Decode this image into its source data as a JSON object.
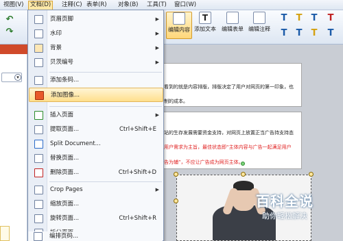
{
  "menubar": {
    "items": [
      {
        "label": "视图(V)"
      },
      {
        "label": "文档(D)"
      },
      {
        "label": "注释(C)"
      },
      {
        "label": "表单(R)"
      },
      {
        "label": "对象(B)"
      },
      {
        "label": "工具(T)"
      },
      {
        "label": "窗口(W)"
      }
    ]
  },
  "toolbar": {
    "edit_content": "编辑内容",
    "add_text": "添加文本",
    "edit_form": "编辑表单",
    "edit_annotation": "编辑注释"
  },
  "doc_menu": {
    "items": [
      {
        "label": "页眉页脚",
        "shortcut": "",
        "submenu": true
      },
      {
        "label": "水印",
        "shortcut": "",
        "submenu": true
      },
      {
        "label": "背景",
        "shortcut": "",
        "submenu": true
      },
      {
        "label": "贝茨编号",
        "shortcut": "",
        "submenu": true
      },
      {
        "label": "添加条码...",
        "shortcut": "",
        "submenu": false
      },
      {
        "label": "添加图像...",
        "shortcut": "",
        "submenu": false,
        "highlighted": true
      },
      {
        "label": "插入页面",
        "shortcut": "",
        "submenu": true
      },
      {
        "label": "提取页面...",
        "shortcut": "Ctrl+Shift+E",
        "submenu": false
      },
      {
        "label": "Split Document...",
        "shortcut": "",
        "submenu": false
      },
      {
        "label": "替换页面...",
        "shortcut": "",
        "submenu": false
      },
      {
        "label": "删除页面...",
        "shortcut": "Ctrl+Shift+D",
        "submenu": false
      },
      {
        "label": "Crop Pages",
        "shortcut": "",
        "submenu": true
      },
      {
        "label": "缩放页面...",
        "shortcut": "",
        "submenu": false
      },
      {
        "label": "旋转页面...",
        "shortcut": "Ctrl+Shift+R",
        "submenu": false
      },
      {
        "label": "拆分页面",
        "shortcut": "",
        "submenu": false
      },
      {
        "label": "编排页码...",
        "shortcut": "",
        "submenu": false
      }
    ]
  },
  "document": {
    "para1_line1": "看到的就是内容排版，排版决定了用户对网页的第一印象，也",
    "para1_line2": "制的成本。",
    "para2_line1": "站的生存发展需要资金支持，对网页上放置正当广告持支持态",
    "para2_line2": "用户需求为主旨，最佳状态即“主体内容与广告一起满足用户",
    "para2_line3": "告为辅”，不应让广告成为网页主体。"
  },
  "watermark": {
    "title": "百科全说",
    "subtitle": "助你轻松解决"
  }
}
